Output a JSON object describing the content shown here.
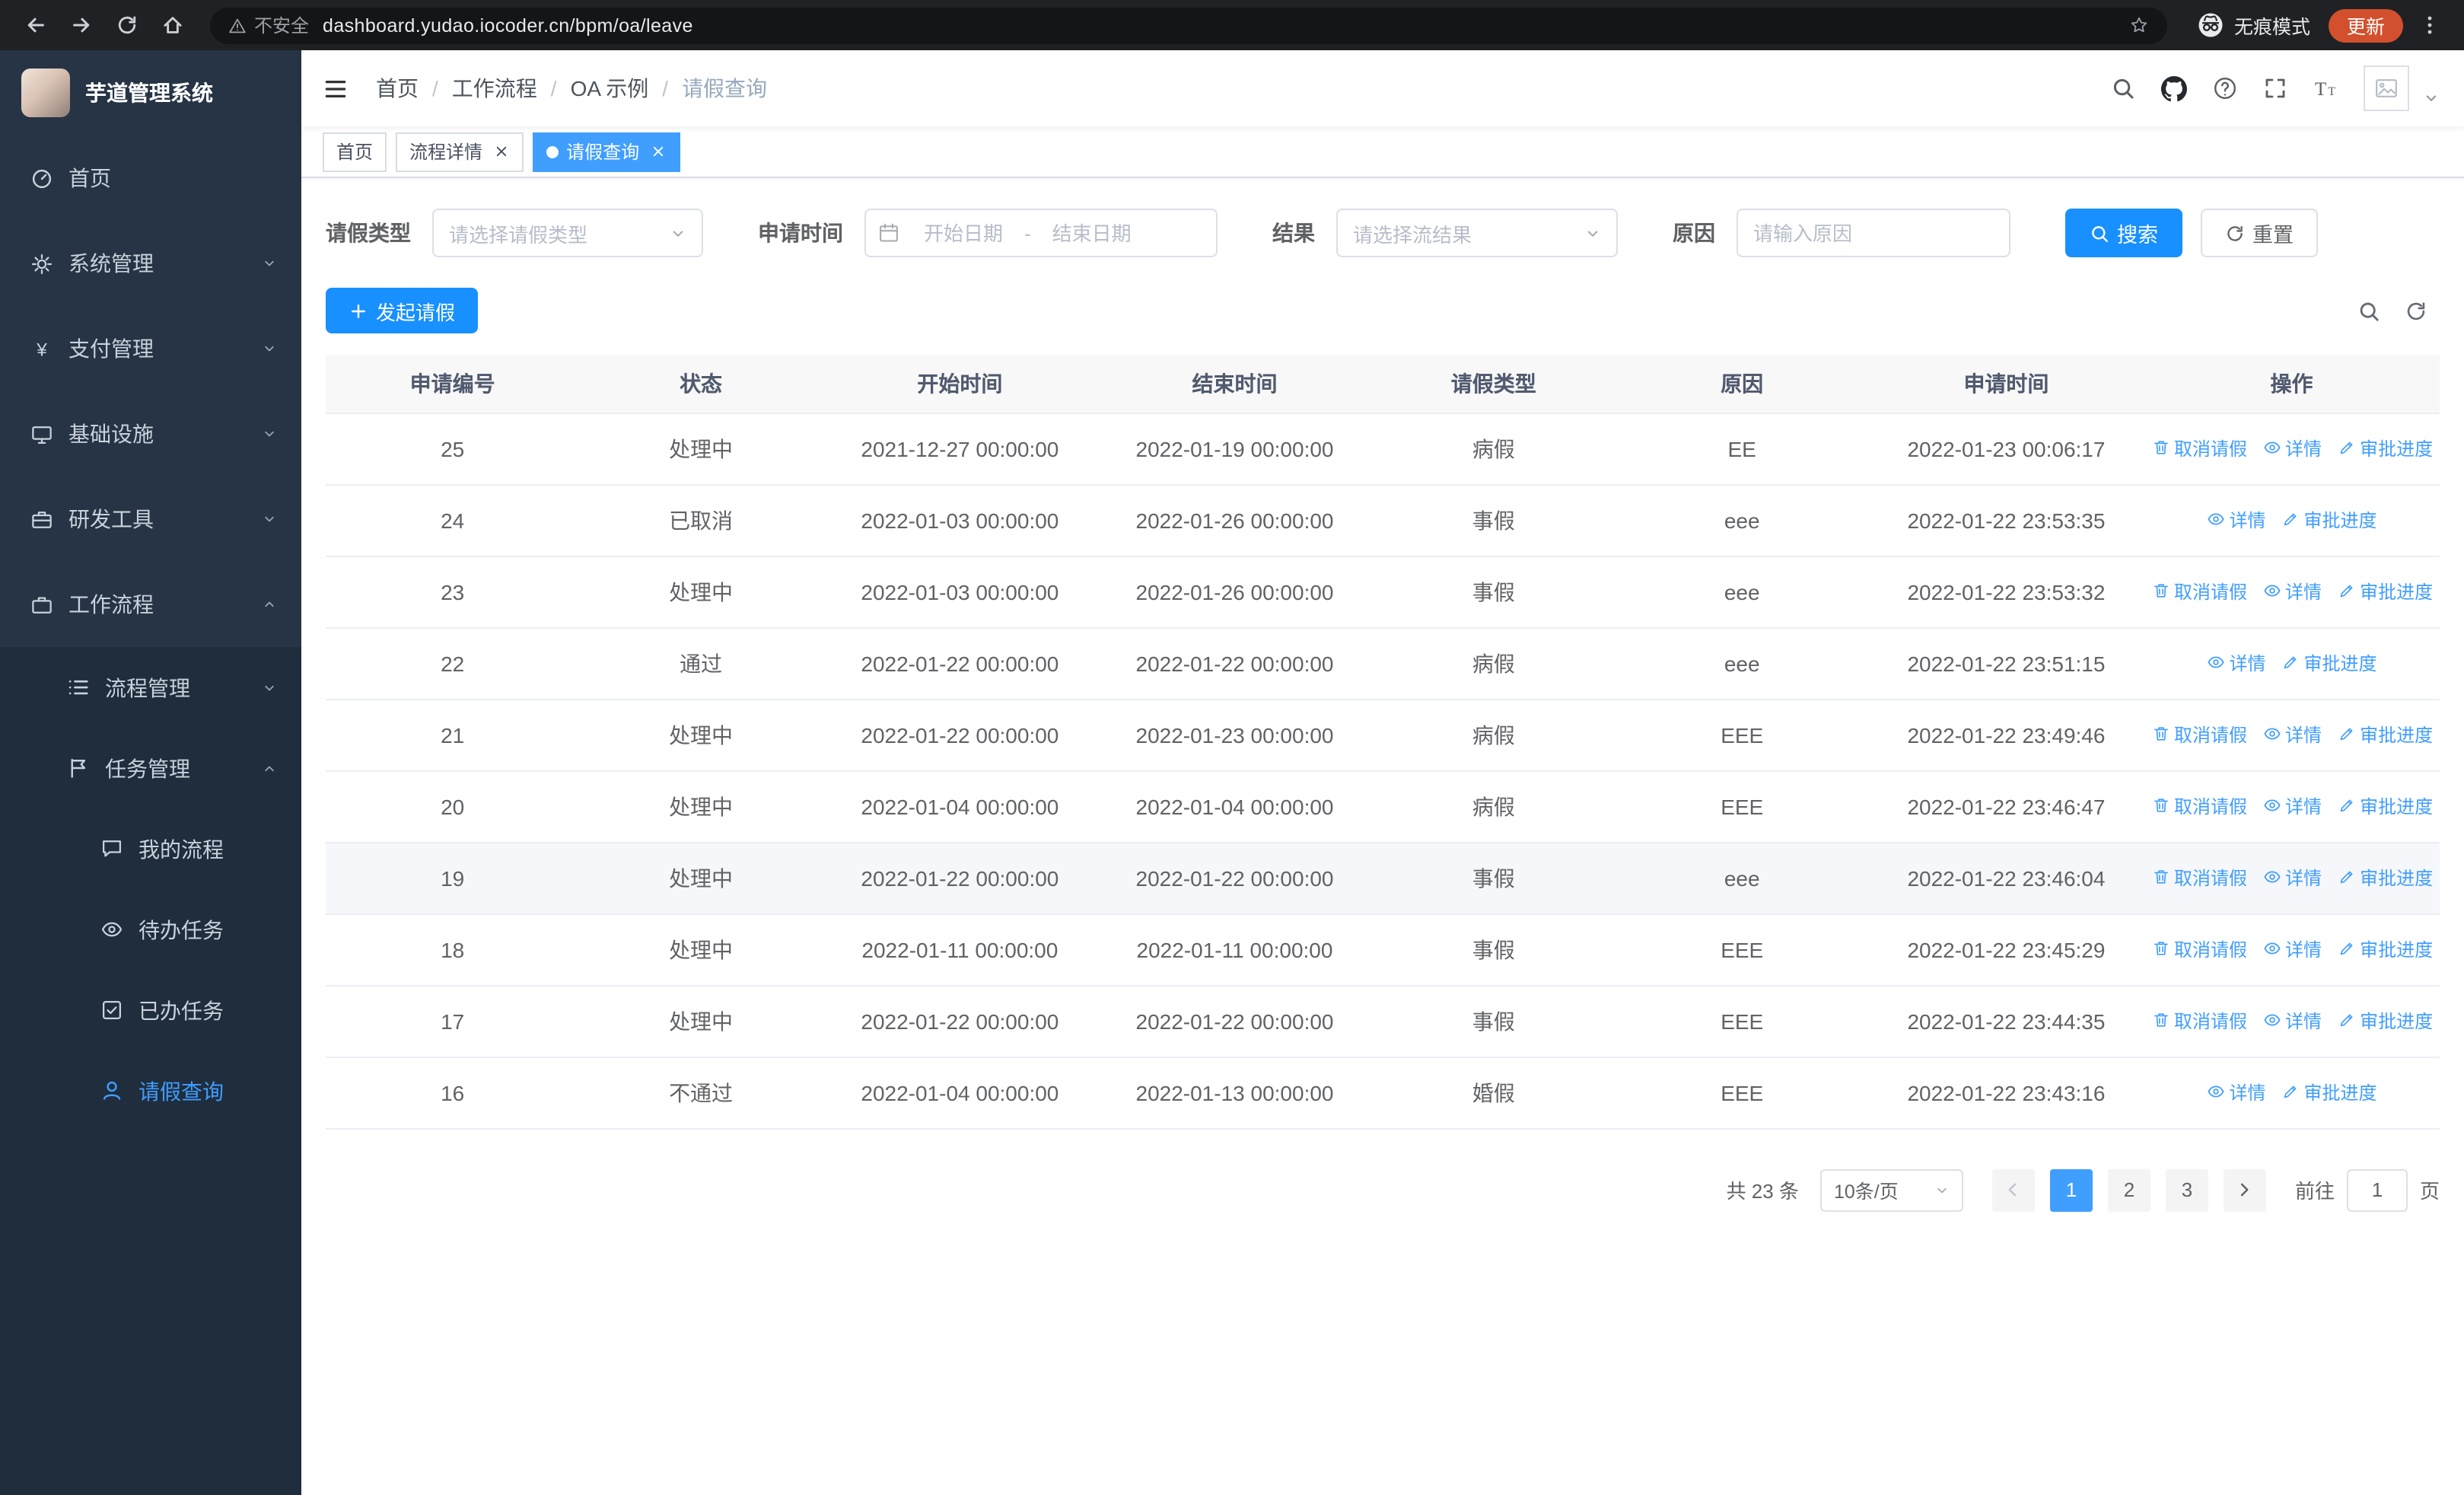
{
  "theme": {
    "primary": "#409eff",
    "button_blue": "#1890ff",
    "update_pill": "#d3502e"
  },
  "browser": {
    "security_label": "不安全",
    "url": "dashboard.yudao.iocoder.cn/bpm/oa/leave",
    "incognito_label": "无痕模式",
    "update_label": "更新"
  },
  "sidebar": {
    "logo_title": "芋道管理系统",
    "items": [
      {
        "key": "home",
        "label": "首页",
        "icon": "dashboard",
        "level": 1
      },
      {
        "key": "system",
        "label": "系统管理",
        "icon": "gear",
        "level": 1,
        "arrow": "down"
      },
      {
        "key": "payment",
        "label": "支付管理",
        "icon": "yen",
        "level": 1,
        "arrow": "down"
      },
      {
        "key": "infrastructure",
        "label": "基础设施",
        "icon": "monitor",
        "level": 1,
        "arrow": "down"
      },
      {
        "key": "devtools",
        "label": "研发工具",
        "icon": "toolbox",
        "level": 1,
        "arrow": "down"
      },
      {
        "key": "workflow",
        "label": "工作流程",
        "icon": "briefcase",
        "level": 1,
        "arrow": "up"
      },
      {
        "key": "process-mgmt",
        "label": "流程管理",
        "icon": "list",
        "level": 2,
        "arrow": "down"
      },
      {
        "key": "task-mgmt",
        "label": "任务管理",
        "icon": "flag",
        "level": 2,
        "arrow": "up"
      },
      {
        "key": "my-process",
        "label": "我的流程",
        "icon": "chat",
        "level": 3
      },
      {
        "key": "todo-tasks",
        "label": "待办任务",
        "icon": "eye",
        "level": 3
      },
      {
        "key": "done-tasks",
        "label": "已办任务",
        "icon": "check-square",
        "level": 3
      },
      {
        "key": "leave-query",
        "label": "请假查询",
        "icon": "user",
        "level": 3,
        "active": true
      }
    ]
  },
  "header": {
    "breadcrumb": [
      "首页",
      "工作流程",
      "OA 示例",
      "请假查询"
    ],
    "separator": "/"
  },
  "tabs": [
    {
      "label": "首页",
      "closable": false,
      "active": false
    },
    {
      "label": "流程详情",
      "closable": true,
      "active": false
    },
    {
      "label": "请假查询",
      "closable": true,
      "active": true
    }
  ],
  "filters": {
    "leave_type_label": "请假类型",
    "leave_type_placeholder": "请选择请假类型",
    "apply_time_label": "申请时间",
    "start_date_placeholder": "开始日期",
    "range_separator": "-",
    "end_date_placeholder": "结束日期",
    "result_label": "结果",
    "result_placeholder": "请选择流结果",
    "reason_label": "原因",
    "reason_placeholder": "请输入原因",
    "search_button": "搜索",
    "reset_button": "重置"
  },
  "toolbar": {
    "create_button": "发起请假"
  },
  "table": {
    "columns": [
      "申请编号",
      "状态",
      "开始时间",
      "结束时间",
      "请假类型",
      "原因",
      "申请时间",
      "操作"
    ],
    "op_labels": {
      "cancel": "取消请假",
      "detail": "详情",
      "progress": "审批进度"
    },
    "rows": [
      {
        "id": "25",
        "status": "处理中",
        "start": "2021-12-27 00:00:00",
        "end": "2022-01-19 00:00:00",
        "type": "病假",
        "reason": "EE",
        "apply_time": "2022-01-23 00:06:17",
        "ops": [
          "cancel",
          "detail",
          "progress"
        ],
        "highlight": false
      },
      {
        "id": "24",
        "status": "已取消",
        "start": "2022-01-03 00:00:00",
        "end": "2022-01-26 00:00:00",
        "type": "事假",
        "reason": "eee",
        "apply_time": "2022-01-22 23:53:35",
        "ops": [
          "detail",
          "progress"
        ],
        "highlight": false
      },
      {
        "id": "23",
        "status": "处理中",
        "start": "2022-01-03 00:00:00",
        "end": "2022-01-26 00:00:00",
        "type": "事假",
        "reason": "eee",
        "apply_time": "2022-01-22 23:53:32",
        "ops": [
          "cancel",
          "detail",
          "progress"
        ],
        "highlight": false
      },
      {
        "id": "22",
        "status": "通过",
        "start": "2022-01-22 00:00:00",
        "end": "2022-01-22 00:00:00",
        "type": "病假",
        "reason": "eee",
        "apply_time": "2022-01-22 23:51:15",
        "ops": [
          "detail",
          "progress"
        ],
        "highlight": false
      },
      {
        "id": "21",
        "status": "处理中",
        "start": "2022-01-22 00:00:00",
        "end": "2022-01-23 00:00:00",
        "type": "病假",
        "reason": "EEE",
        "apply_time": "2022-01-22 23:49:46",
        "ops": [
          "cancel",
          "detail",
          "progress"
        ],
        "highlight": false
      },
      {
        "id": "20",
        "status": "处理中",
        "start": "2022-01-04 00:00:00",
        "end": "2022-01-04 00:00:00",
        "type": "病假",
        "reason": "EEE",
        "apply_time": "2022-01-22 23:46:47",
        "ops": [
          "cancel",
          "detail",
          "progress"
        ],
        "highlight": false
      },
      {
        "id": "19",
        "status": "处理中",
        "start": "2022-01-22 00:00:00",
        "end": "2022-01-22 00:00:00",
        "type": "事假",
        "reason": "eee",
        "apply_time": "2022-01-22 23:46:04",
        "ops": [
          "cancel",
          "detail",
          "progress"
        ],
        "highlight": true
      },
      {
        "id": "18",
        "status": "处理中",
        "start": "2022-01-11 00:00:00",
        "end": "2022-01-11 00:00:00",
        "type": "事假",
        "reason": "EEE",
        "apply_time": "2022-01-22 23:45:29",
        "ops": [
          "cancel",
          "detail",
          "progress"
        ],
        "highlight": false
      },
      {
        "id": "17",
        "status": "处理中",
        "start": "2022-01-22 00:00:00",
        "end": "2022-01-22 00:00:00",
        "type": "事假",
        "reason": "EEE",
        "apply_time": "2022-01-22 23:44:35",
        "ops": [
          "cancel",
          "detail",
          "progress"
        ],
        "highlight": false
      },
      {
        "id": "16",
        "status": "不通过",
        "start": "2022-01-04 00:00:00",
        "end": "2022-01-13 00:00:00",
        "type": "婚假",
        "reason": "EEE",
        "apply_time": "2022-01-22 23:43:16",
        "ops": [
          "detail",
          "progress"
        ],
        "highlight": false
      }
    ]
  },
  "pagination": {
    "total_text": "共 23 条",
    "page_size": "10条/页",
    "pages": [
      "1",
      "2",
      "3"
    ],
    "active_page": "1",
    "goto_label": "前往",
    "goto_value": "1",
    "goto_suffix": "页"
  }
}
